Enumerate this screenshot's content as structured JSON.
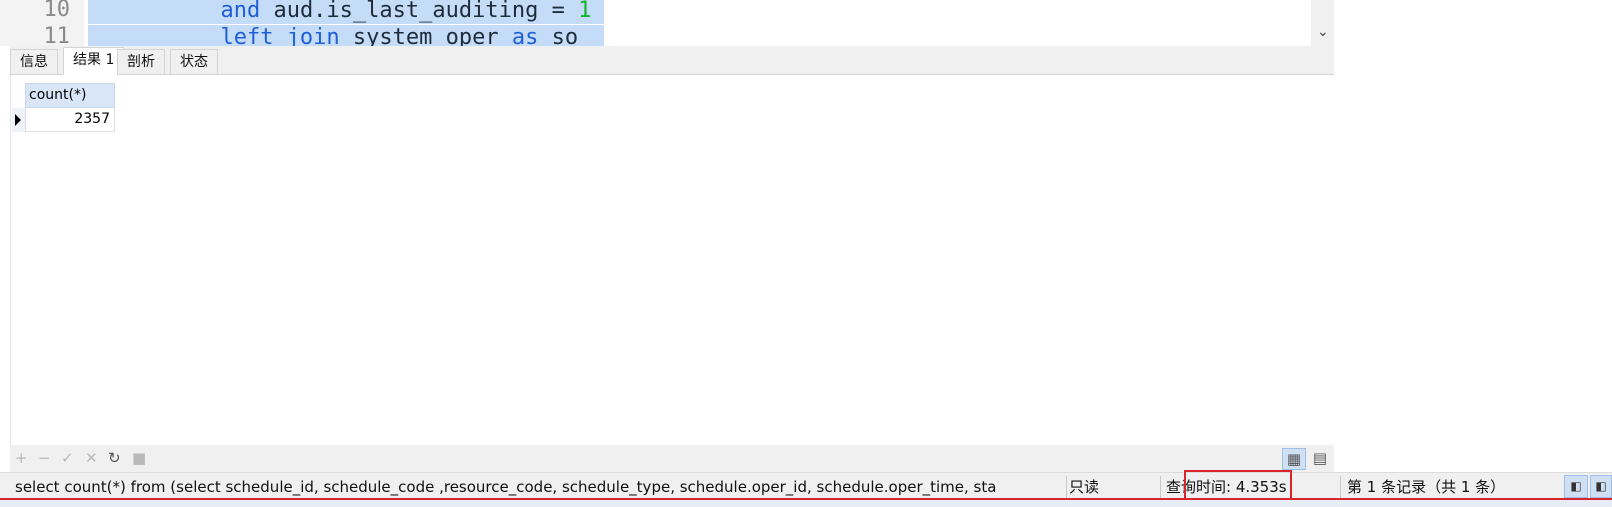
{
  "editor": {
    "lines": [
      {
        "number": "10",
        "indent": "          ",
        "tokens": [
          {
            "text": "and",
            "cls": "kw"
          },
          {
            "text": " aud.is_last_auditing = ",
            "cls": "id"
          },
          {
            "text": "1",
            "cls": "num"
          }
        ]
      },
      {
        "number": "11",
        "indent": "          ",
        "tokens": [
          {
            "text": "left join",
            "cls": "kw"
          },
          {
            "text": " system_oper ",
            "cls": "id"
          },
          {
            "text": "as",
            "cls": "kw"
          },
          {
            "text": " so",
            "cls": "id"
          }
        ]
      }
    ],
    "scroll_icon": "chevron-down-icon"
  },
  "tabs": [
    {
      "label": "信息",
      "active": false
    },
    {
      "label": "结果 1",
      "active": true
    },
    {
      "label": "剖析",
      "active": false
    },
    {
      "label": "状态",
      "active": false
    }
  ],
  "result": {
    "columns": [
      "count(*)"
    ],
    "rows": [
      [
        "2357"
      ]
    ]
  },
  "toolbar": {
    "icons": [
      "plus-icon",
      "minus-icon",
      "check-icon",
      "x-icon",
      "refresh-icon",
      "stop-icon"
    ],
    "view_icons": [
      "grid-view-icon",
      "form-view-icon"
    ]
  },
  "status": {
    "sql": "select count(*) from (select          schedule_id, schedule_code ,resource_code, schedule_type, schedule.oper_id, schedule.oper_time,          sta",
    "mode": "只读",
    "query_time": "查询时间: 4.353s",
    "record_info": "第 1 条记录（共 1 条）"
  },
  "colors": {
    "selection": "#c5dcf8",
    "keyword": "#1f5fd6",
    "number": "#13b32d",
    "highlight_box": "#d9262c"
  }
}
